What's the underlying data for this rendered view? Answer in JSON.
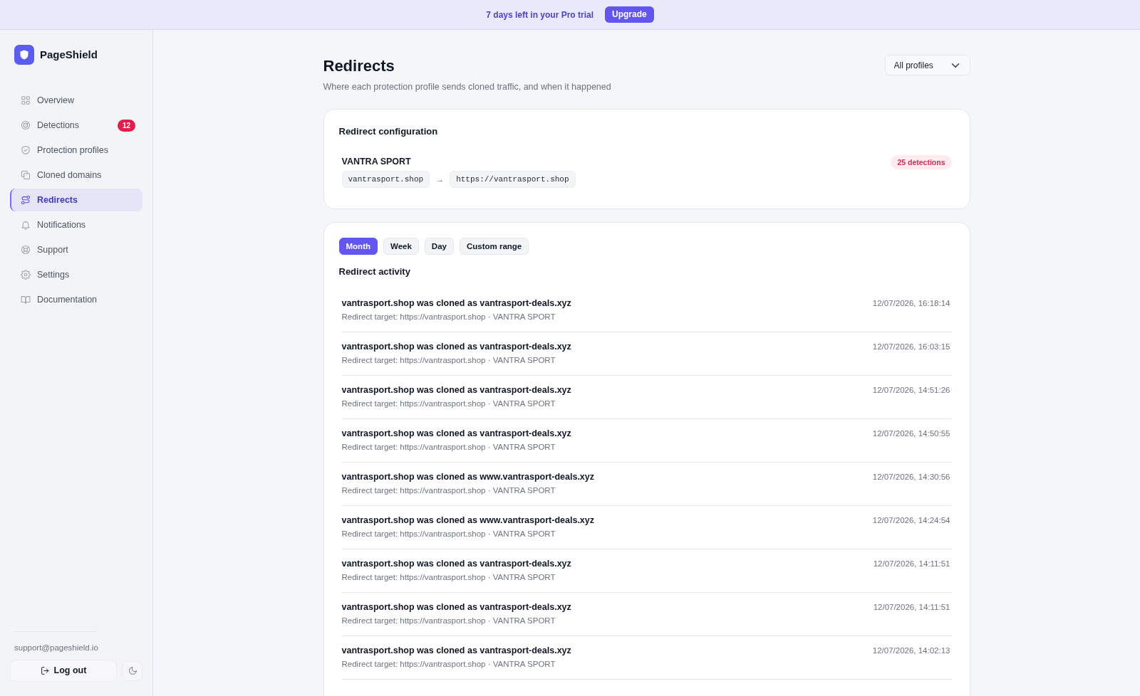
{
  "trial_banner": {
    "text": "7 days left in your Pro trial",
    "button": "Upgrade"
  },
  "sidebar": {
    "brand": "PageShield",
    "items": [
      {
        "label": "Overview",
        "selected": false
      },
      {
        "label": "Detections",
        "badge": "12",
        "selected": false
      },
      {
        "label": "Protection profiles",
        "selected": false
      },
      {
        "label": "Cloned domains",
        "selected": false
      },
      {
        "label": "Redirects",
        "selected": true
      },
      {
        "label": "Notifications",
        "selected": false
      },
      {
        "label": "Support",
        "selected": false
      },
      {
        "label": "Settings",
        "selected": false
      },
      {
        "label": "Documentation",
        "selected": false
      }
    ],
    "footer": {
      "email": "support@pageshield.io",
      "logout": "Log out"
    }
  },
  "header": {
    "title": "Redirects",
    "subtitle": "Where each protection profile sends cloned traffic, and when it happened",
    "profile_filter": {
      "value": "All profiles"
    }
  },
  "config_card": {
    "title": "Redirect configuration",
    "profile": "VANTRA SPORT",
    "badge": "25 detections",
    "source": "vantrasport.shop",
    "arrow": "→",
    "target": "https://vantrasport.shop"
  },
  "activity": {
    "ranges": [
      {
        "label": "Month",
        "selected": true
      },
      {
        "label": "Week",
        "selected": false
      },
      {
        "label": "Day",
        "selected": false
      },
      {
        "label": "Custom range",
        "selected": false
      }
    ],
    "title": "Redirect activity",
    "rows": [
      {
        "title": "vantrasport.shop was cloned as vantrasport-deals.xyz",
        "detail": "Redirect target: https://vantrasport.shop · VANTRA SPORT",
        "time": "12/07/2026, 16:18:14"
      },
      {
        "title": "vantrasport.shop was cloned as vantrasport-deals.xyz",
        "detail": "Redirect target: https://vantrasport.shop · VANTRA SPORT",
        "time": "12/07/2026, 16:03:15"
      },
      {
        "title": "vantrasport.shop was cloned as vantrasport-deals.xyz",
        "detail": "Redirect target: https://vantrasport.shop · VANTRA SPORT",
        "time": "12/07/2026, 14:51:26"
      },
      {
        "title": "vantrasport.shop was cloned as vantrasport-deals.xyz",
        "detail": "Redirect target: https://vantrasport.shop · VANTRA SPORT",
        "time": "12/07/2026, 14:50:55"
      },
      {
        "title": "vantrasport.shop was cloned as www.vantrasport-deals.xyz",
        "detail": "Redirect target: https://vantrasport.shop · VANTRA SPORT",
        "time": "12/07/2026, 14:30:56"
      },
      {
        "title": "vantrasport.shop was cloned as www.vantrasport-deals.xyz",
        "detail": "Redirect target: https://vantrasport.shop · VANTRA SPORT",
        "time": "12/07/2026, 14:24:54"
      },
      {
        "title": "vantrasport.shop was cloned as vantrasport-deals.xyz",
        "detail": "Redirect target: https://vantrasport.shop · VANTRA SPORT",
        "time": "12/07/2026, 14:11:51"
      },
      {
        "title": "vantrasport.shop was cloned as vantrasport-deals.xyz",
        "detail": "Redirect target: https://vantrasport.shop · VANTRA SPORT",
        "time": "12/07/2026, 14:11:51"
      },
      {
        "title": "vantrasport.shop was cloned as vantrasport-deals.xyz",
        "detail": "Redirect target: https://vantrasport.shop · VANTRA SPORT",
        "time": "12/07/2026, 14:02:13"
      }
    ]
  }
}
